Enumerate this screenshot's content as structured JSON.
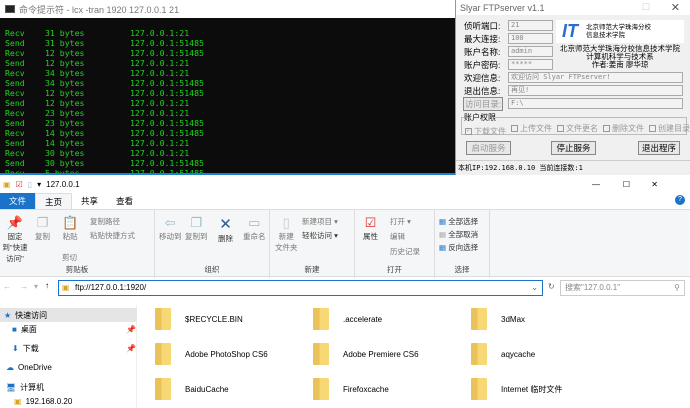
{
  "terminal": {
    "title": "命令提示符 - lcx  -tran 1920 127.0.0.1 21",
    "lines": [
      [
        "Recv",
        "31 bytes",
        "127.0.0.1:21"
      ],
      [
        "Send",
        "31 bytes",
        "127.0.0.1:51485"
      ],
      [
        "Recv",
        "12 bytes",
        "127.0.0.1:51485"
      ],
      [
        "Send",
        "12 bytes",
        "127.0.0.1:21"
      ],
      [
        "Recv",
        "34 bytes",
        "127.0.0.1:21"
      ],
      [
        "Send",
        "34 bytes",
        "127.0.0.1:51485"
      ],
      [
        "Recv",
        "12 bytes",
        "127.0.0.1:51485"
      ],
      [
        "Send",
        "12 bytes",
        "127.0.0.1:21"
      ],
      [
        "Recv",
        "23 bytes",
        "127.0.0.1:21"
      ],
      [
        "Send",
        "23 bytes",
        "127.0.0.1:51485"
      ],
      [
        "Recv",
        "14 bytes",
        "127.0.0.1:51485"
      ],
      [
        "Send",
        "14 bytes",
        "127.0.0.1:21"
      ],
      [
        "Recv",
        "30 bytes",
        "127.0.0.1:21"
      ],
      [
        "Send",
        "30 bytes",
        "127.0.0.1:51485"
      ],
      [
        "Recv",
        "5 bytes",
        "127.0.0.1:51485"
      ]
    ]
  },
  "ftp": {
    "title": "Slyar FTPserver v1.1",
    "port_label": "侦听端口:",
    "port": "21",
    "maxconn_label": "最大连接:",
    "maxconn": "100",
    "user_label": "账户名称:",
    "user": "admin",
    "pass_label": "账户密码:",
    "pass": "*****",
    "welcome_label": "欢迎信息:",
    "welcome": "欢迎访问 Slyar FTPserver!",
    "exit_label": "退出信息:",
    "exit": "再见!",
    "dir_button": "访问目录:",
    "dir": "F:\\",
    "logo_text": "IT",
    "logo_school": "北京师范大学珠海分校 信息技术学院",
    "school": "北京师范大学珠海分校信息技术学院",
    "dept": "计算机科学与技术系",
    "author": "作者:姜南 廖华琼",
    "perm_label": "账户权限",
    "perms": [
      {
        "label": "下载文件",
        "checked": true
      },
      {
        "label": "上传文件",
        "checked": false
      },
      {
        "label": "文件更名",
        "checked": false
      },
      {
        "label": "删除文件",
        "checked": false
      },
      {
        "label": "创建目录",
        "checked": false
      }
    ],
    "start": "启动服务",
    "stop": "停止服务",
    "quit": "退出程序",
    "status": "本机IP:192.168.0.10 当前连接数:1"
  },
  "explorer": {
    "title": "127.0.0.1",
    "tabs": [
      "文件",
      "主页",
      "共享",
      "查看"
    ],
    "ribbon": {
      "pin": "固定到\"快速访问\"",
      "copy": "复制",
      "paste": "粘贴",
      "copy_path": "复制路径",
      "paste_shortcut": "粘贴快捷方式",
      "cut": "剪切",
      "clipboard": "剪贴板",
      "move_to": "移动到",
      "copy_to": "复制到",
      "delete": "删除",
      "rename": "重命名",
      "organize": "组织",
      "new_folder": "新建\n文件夹",
      "new_item": "新建项目 ▾",
      "easy_access": "轻松访问 ▾",
      "new": "新建",
      "properties": "属性",
      "open": "打开 ▾",
      "edit": "编辑",
      "history": "历史记录",
      "open_group": "打开",
      "select_all": "全部选择",
      "select_none": "全部取消",
      "invert": "反向选择",
      "select": "选择"
    },
    "address": "ftp://127.0.0.1:1920/",
    "search_placeholder": "搜索\"127.0.0.1\"",
    "sidebar": [
      "快速访问",
      "桌面",
      "下载",
      "OneDrive",
      "计算机",
      "192.168.0.20"
    ],
    "folders": [
      "$RECYCLE.BIN",
      ".accelerate",
      "3dMax",
      "Adobe PhotoShop CS6",
      "Adobe Premiere CS6",
      "aqycache",
      "BaiduCache",
      "Firefoxcache",
      "Internet 临时文件"
    ]
  }
}
